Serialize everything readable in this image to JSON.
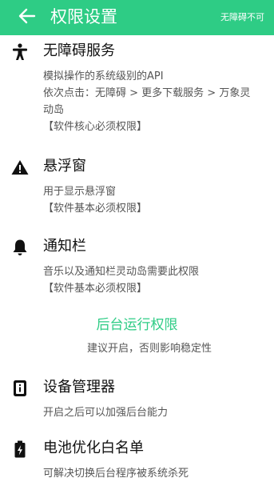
{
  "header": {
    "title": "权限设置",
    "status_right": "无障碍不可",
    "back_icon": "arrow-left-icon",
    "background": "#2ecc85"
  },
  "permissions": [
    {
      "icon": "accessibility-person-icon",
      "title": "无障碍服务",
      "lines": [
        "模拟操作的系统级别的API",
        "依次点击：无障碍 > 更多下载服务 > 万象灵",
        "动岛",
        "【软件核心必须权限】"
      ]
    },
    {
      "icon": "warning-triangle-icon",
      "title": "悬浮窗",
      "lines": [
        "用于显示悬浮窗",
        "【软件基本必须权限】"
      ]
    },
    {
      "icon": "bell-icon",
      "title": "通知栏",
      "lines": [
        "音乐以及通知栏灵动岛需要此权限",
        "【软件基本必须权限】"
      ]
    }
  ],
  "background_section": {
    "title": "后台运行权限",
    "subtitle": "建议开启，否则影响稳定性",
    "accent": "#2ecc85"
  },
  "background_permissions": [
    {
      "icon": "device-admin-icon",
      "title": "设备管理器",
      "lines": [
        "开启之后可以加强后台能力"
      ]
    },
    {
      "icon": "battery-icon",
      "title": "电池优化白名单",
      "lines": [
        "可解决切换后台程序被系统杀死"
      ]
    }
  ]
}
